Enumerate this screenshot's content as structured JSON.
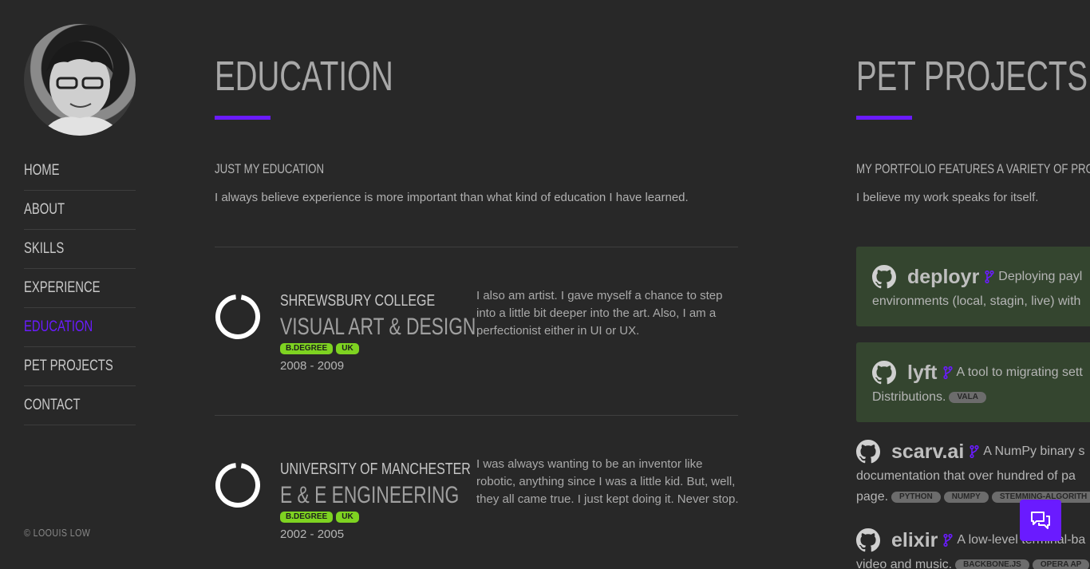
{
  "sidebar": {
    "nav": [
      {
        "label": "HOME"
      },
      {
        "label": "ABOUT"
      },
      {
        "label": "SKILLS"
      },
      {
        "label": "EXPERIENCE"
      },
      {
        "label": "EDUCATION",
        "active": true
      },
      {
        "label": "PET PROJECTS"
      },
      {
        "label": "CONTACT"
      }
    ],
    "copyright": "© LOOUIS LOW"
  },
  "education": {
    "title": "EDUCATION",
    "subhead": "JUST MY EDUCATION",
    "intro": "I always believe experience is more important than what kind of education I have learned.",
    "items": [
      {
        "school": "SHREWSBURY COLLEGE",
        "degree": "VISUAL ART & DESIGN",
        "badges": [
          "B.DEGREE",
          "UK"
        ],
        "years": "2008 - 2009",
        "description": "I also am artist. I gave myself a chance to step into a little bit deeper into the art. Also, I am a perfectionist either in UI or UX."
      },
      {
        "school": "UNIVERSITY OF MANCHESTER",
        "degree": "E & E ENGINEERING",
        "badges": [
          "B.DEGREE",
          "UK"
        ],
        "years": "2002 - 2005",
        "description": "I was always wanting to be an inventor like robotic, anything since I was a little kid. But, well, they all came true. I just kept doing it. Never stop."
      }
    ]
  },
  "projects": {
    "title": "PET PROJECTS",
    "subhead": "MY PORTFOLIO FEATURES A VARIETY OF PROJECTS",
    "intro": "I believe my work speaks for itself.",
    "items": [
      {
        "name": "deployr",
        "desc1": "Deploying payl",
        "desc2": "environments (local, stagin, live) with",
        "tags": []
      },
      {
        "name": "lyft",
        "desc1": "A tool to migrating sett",
        "desc2": "Distributions.",
        "tags": [
          "VALA"
        ]
      },
      {
        "name": "scarv.ai",
        "desc1": "A NumPy binary s",
        "desc2": "documentation that over hundred of pa",
        "desc3": "page.",
        "tags": [
          "PYTHON",
          "NUMPY",
          "STEMMING-ALGORITH"
        ]
      },
      {
        "name": "elixir",
        "desc1": "A low-level terminal-ba",
        "desc2": "video and music.",
        "tags": [
          "BACKBONE.JS",
          "OPERA AP"
        ]
      }
    ]
  },
  "colors": {
    "accent": "#6a1bff",
    "badge": "#7ed321",
    "card": "#34452f"
  },
  "icons": {
    "project": "github-icon",
    "fork": "fork-icon",
    "chat": "chat-icon"
  }
}
